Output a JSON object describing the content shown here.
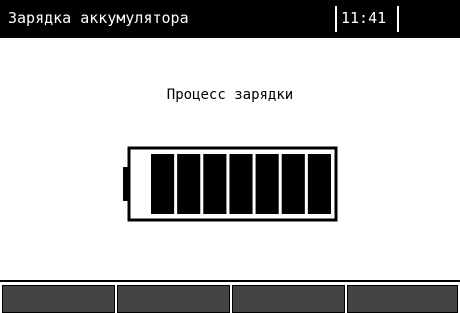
{
  "header": {
    "title": "Зарядка аккумулятора",
    "clock": "11:41"
  },
  "main": {
    "status_text": "Процесс зарядки"
  },
  "battery": {
    "total_segments": 7,
    "filled_segments": 7,
    "charge_fraction": 1.0
  },
  "softkeys": [
    {
      "label": ""
    },
    {
      "label": ""
    },
    {
      "label": ""
    },
    {
      "label": ""
    }
  ],
  "colors": {
    "screen_background": "#ffffff",
    "title_bar_background": "#000000",
    "title_text": "#ffffff",
    "battery_segment": "#000000",
    "softkey_background": "#444444"
  }
}
